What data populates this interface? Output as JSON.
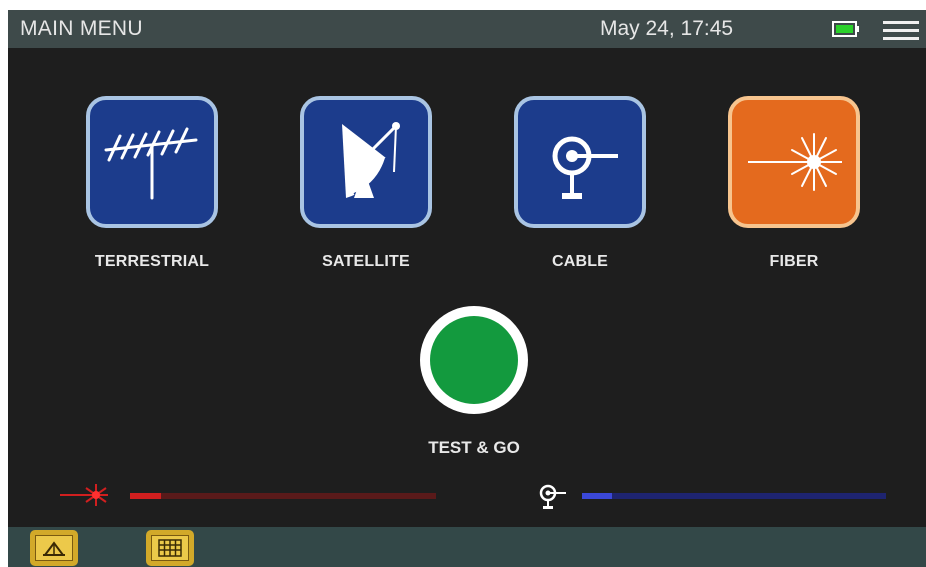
{
  "header": {
    "title": "MAIN MENU",
    "datetime": "May 24, 17:45",
    "battery_icon": "battery-full-icon",
    "menu_icon": "hamburger-menu-icon"
  },
  "tiles": [
    {
      "label": "TERRESTRIAL",
      "icon": "antenna-icon",
      "color": "#1c3c8c"
    },
    {
      "label": "SATELLITE",
      "icon": "satellite-dish-icon",
      "color": "#1c3c8c"
    },
    {
      "label": "CABLE",
      "icon": "coax-cable-icon",
      "color": "#1c3c8c"
    },
    {
      "label": "FIBER",
      "icon": "laser-burst-icon",
      "color": "#e46a1e"
    }
  ],
  "test_go": {
    "label": "TEST & GO",
    "color": "#139a3e"
  },
  "status_bars": {
    "laser": {
      "icon": "laser-icon",
      "level": 0.1,
      "color": "#d11f1f"
    },
    "cable": {
      "icon": "coax-cable-icon",
      "level": 0.1,
      "color": "#3b48d8"
    }
  },
  "footer": {
    "buttons": [
      {
        "icon": "antenna-folder-icon"
      },
      {
        "icon": "grid-table-icon"
      }
    ]
  }
}
